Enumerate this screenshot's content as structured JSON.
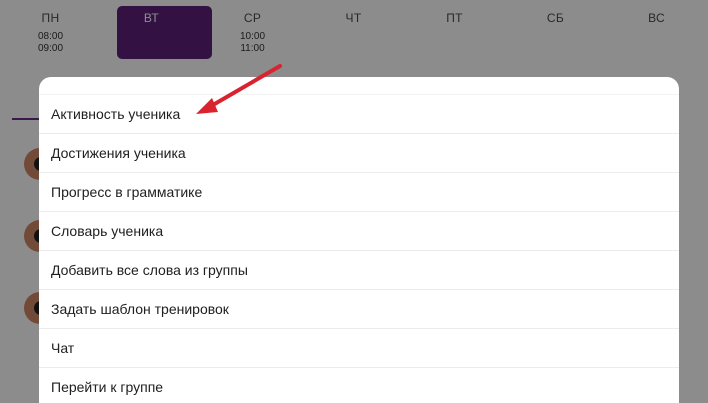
{
  "week": {
    "days": [
      {
        "name": "ПН",
        "times": [
          "08:00",
          "09:00"
        ],
        "selected": false
      },
      {
        "name": "ВТ",
        "times": [],
        "selected": true
      },
      {
        "name": "СР",
        "times": [
          "10:00",
          "11:00"
        ],
        "selected": false
      },
      {
        "name": "ЧТ",
        "times": [],
        "selected": false
      },
      {
        "name": "ПТ",
        "times": [],
        "selected": false
      },
      {
        "name": "СБ",
        "times": [],
        "selected": false
      },
      {
        "name": "ВС",
        "times": [],
        "selected": false
      }
    ],
    "selected_color": "#5e217a"
  },
  "menu": {
    "items": [
      {
        "label": "Активность ученика"
      },
      {
        "label": "Достижения ученика"
      },
      {
        "label": "Прогресс в грамматике"
      },
      {
        "label": "Словарь ученика"
      },
      {
        "label": "Добавить все слова из группы"
      },
      {
        "label": "Задать шаблон тренировок"
      },
      {
        "label": "Чат"
      },
      {
        "label": "Перейти к группе"
      }
    ]
  },
  "annotation": {
    "icon": "red-arrow-icon",
    "color": "#d9232e"
  }
}
